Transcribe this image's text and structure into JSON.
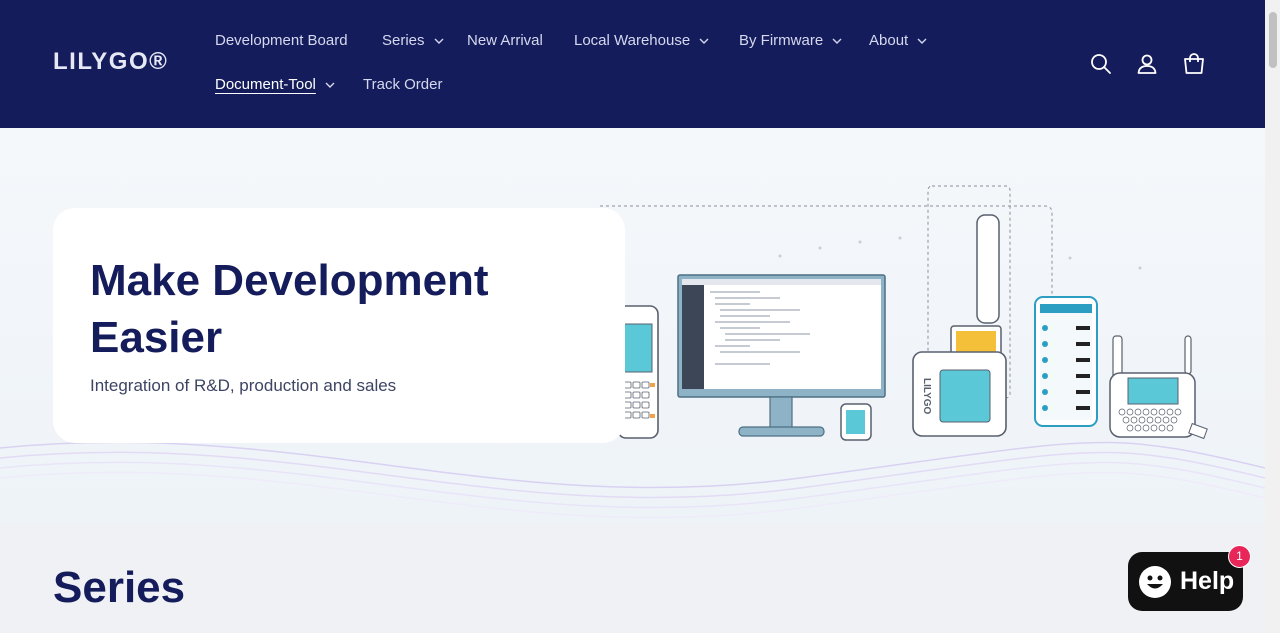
{
  "header": {
    "logo": "LILYGO®",
    "nav": [
      {
        "label": "Development Board",
        "has_dropdown": false
      },
      {
        "label": "Series",
        "has_dropdown": true
      },
      {
        "label": "New Arrival",
        "has_dropdown": false
      },
      {
        "label": "Local Warehouse",
        "has_dropdown": true
      },
      {
        "label": "By Firmware",
        "has_dropdown": true
      },
      {
        "label": "About",
        "has_dropdown": true
      },
      {
        "label": "Document-Tool",
        "has_dropdown": true,
        "active": true
      },
      {
        "label": "Track Order",
        "has_dropdown": false
      }
    ],
    "icons": [
      "search-icon",
      "account-icon",
      "cart-icon"
    ]
  },
  "hero": {
    "title": "Make Development Easier",
    "subtitle": "Integration of R&D, production and sales",
    "device_label": "LILYGO"
  },
  "series": {
    "title": "Series"
  },
  "help": {
    "label": "Help",
    "badge": "1"
  },
  "colors": {
    "header_bg": "#141c5b",
    "accent": "#141c5b",
    "badge": "#e8265a",
    "device_screen": "#5bc8d8"
  }
}
